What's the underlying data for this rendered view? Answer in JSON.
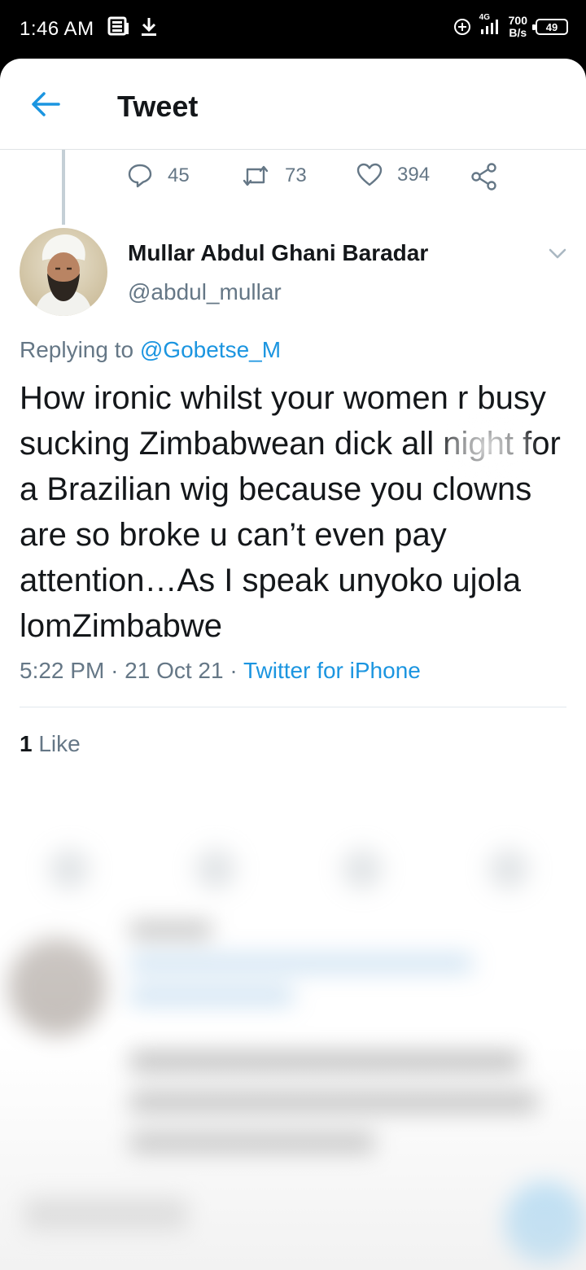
{
  "status_bar": {
    "time": "1:46 AM",
    "network": "4G",
    "speed_value": "700",
    "speed_unit": "B/s",
    "battery": "49"
  },
  "header": {
    "title": "Tweet"
  },
  "previous_tweet_actions": {
    "replies": "45",
    "retweets": "73",
    "likes": "394"
  },
  "tweet": {
    "author_name": "Mullar Abdul Ghani Baradar",
    "author_handle": "@abdul_mullar",
    "replying_prefix": "Replying to",
    "replying_to": "@Gobetse_M",
    "text": "How ironic whilst your women r busy sucking Zimbabwean dick all night for a Brazilian wig because you clowns are so broke u can’t even pay attention…As I speak unyoko ujola lomZimbabwe",
    "time": "5:22 PM",
    "date": "21 Oct 21",
    "source": "Twitter for iPhone",
    "likes_count": "1",
    "likes_label": "Like"
  },
  "colors": {
    "accent": "#1b95e0",
    "text_primary": "#14171a",
    "text_secondary": "#657786"
  },
  "icons": [
    "back-arrow-icon",
    "reply-icon",
    "retweet-icon",
    "heart-icon",
    "share-icon",
    "chevron-down-icon"
  ]
}
